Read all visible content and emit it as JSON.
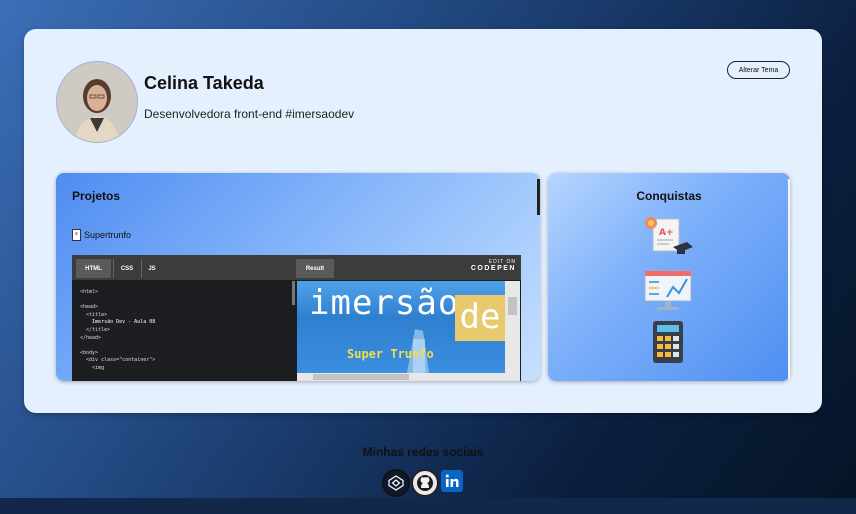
{
  "profile": {
    "name": "Celina Takeda",
    "bio": "Desenvolvedora front-end #imersaodev",
    "theme_button": "Alterar Tema"
  },
  "projects": {
    "title": "Projetos",
    "items": [
      {
        "label": "Supertrunfo"
      }
    ],
    "embed": {
      "tabs": [
        "HTML",
        "CSS",
        "JS"
      ],
      "result_tab": "Result",
      "edit_on": "EDIT ON",
      "brand": "CODEPEN",
      "code_lines": [
        "<html>",
        "",
        "<head>",
        "  <title>",
        "    Imersão Dev - Aula 08",
        "  </title>",
        "</head>",
        "",
        "<body>",
        "  <div class=\"container\">",
        "    <img"
      ],
      "result_banner": "imersão",
      "result_banner_box": "de",
      "result_subtitle": "Super Trunfo"
    }
  },
  "achievements": {
    "title": "Conquistas",
    "icons": [
      "certificate-icon",
      "analytics-board-icon",
      "calculator-icon"
    ]
  },
  "footer": {
    "title": "Minhas redes sociais",
    "links": [
      "codepen-icon",
      "github-icon",
      "linkedin-icon"
    ]
  },
  "colors": {
    "card_bg": "#e5f0ff",
    "panel_accent": "#4f8cf2",
    "page_bg_dark": "#061427",
    "linkedin": "#0a66c2"
  }
}
